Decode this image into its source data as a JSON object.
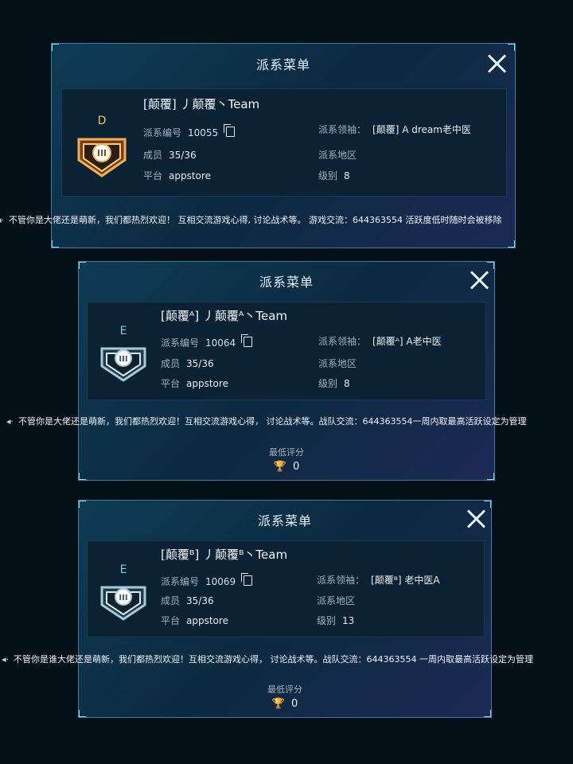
{
  "panels": [
    {
      "title": "派系菜单",
      "rank_letter": "D",
      "team_name": "[颠覆] 丿颠覆丶Team",
      "id_label": "派系编号",
      "id_value": "10055",
      "members_label": "成员",
      "members_value": "35/36",
      "platform_label": "平台",
      "platform_value": "appstore",
      "leader_label": "派系领袖：",
      "leader_value": "[颠覆] A dream老中医",
      "region_label": "派系地区",
      "level_label": "级别",
      "level_value": "8",
      "announcement": "不管你是大佬还是萌新，我们都热烈欢迎！ 互相交流游戏心得, 讨论战术等。 游戏交流：644363554 活跃度低时随时会被移除",
      "badge_color": "gold"
    },
    {
      "title": "派系菜单",
      "rank_letter": "E",
      "team_name": "[颠覆ᴬ] 丿颠覆ᴬ丶Team",
      "id_label": "派系编号",
      "id_value": "10064",
      "members_label": "成员",
      "members_value": "35/36",
      "platform_label": "平台",
      "platform_value": "appstore",
      "leader_label": "派系领袖：",
      "leader_value": "[颠覆ᴬ] A老中医",
      "region_label": "派系地区",
      "level_label": "级别",
      "level_value": "8",
      "announcement": "不管你是大佬还是萌新，我们都热烈欢迎！互相交流游戏心得， 讨论战术等。战队交流：644363554一周内取最高活跃设定为管理",
      "min_score_label": "最低评分",
      "min_score_value": "0",
      "badge_color": "silver"
    },
    {
      "title": "派系菜单",
      "rank_letter": "E",
      "team_name": "[颠覆ᴮ] 丿颠覆ᴮ丶Team",
      "id_label": "派系编号",
      "id_value": "10069",
      "members_label": "成员",
      "members_value": "35/36",
      "platform_label": "平台",
      "platform_value": "appstore",
      "leader_label": "派系领袖：",
      "leader_value": "[颠覆ᴮ] 老中医A",
      "region_label": "派系地区",
      "level_label": "级别",
      "level_value": "13",
      "announcement": "不管你是谁大佬还是萌新，我们都热烈欢迎！互相交流游戏心得， 讨论战术等。战队交流：644363554 一周内取最高活跃设定为管理",
      "min_score_label": "最低评分",
      "min_score_value": "0",
      "badge_color": "silver"
    }
  ],
  "icons": {
    "close": "close-icon",
    "copy": "copy-icon",
    "speaker": "speaker-icon",
    "trophy": "trophy-icon"
  },
  "colors": {
    "gold_badge": "#d79a3a",
    "silver_badge": "#9fb7c6",
    "accent_border": "#7fe3ff",
    "trophy": "#f1c34b"
  }
}
